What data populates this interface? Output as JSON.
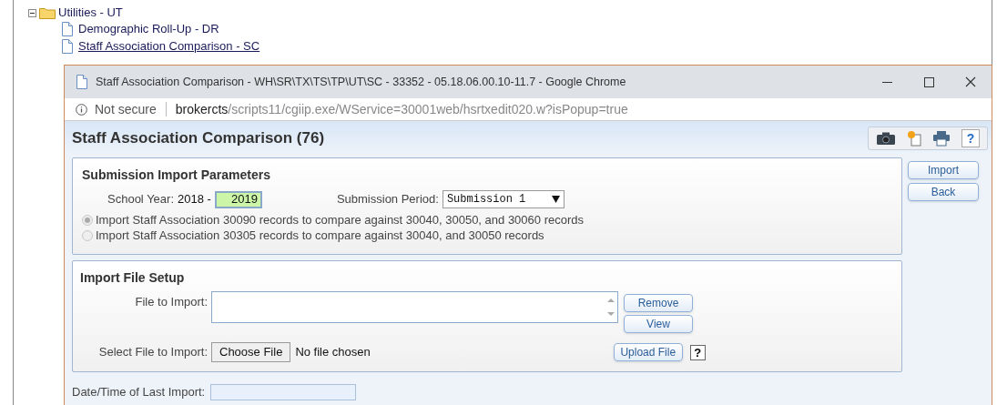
{
  "tree": {
    "label": "Utilities - UT",
    "expanded": true,
    "children": [
      {
        "label": "Demographic Roll-Up - DR",
        "selected": false
      },
      {
        "label": "Staff Association Comparison - SC",
        "selected": true
      }
    ]
  },
  "browser": {
    "title": "Staff Association Comparison - WH\\SR\\TX\\TS\\TP\\UT\\SC - 33352 - 05.18.06.00.10-11.7 - Google Chrome",
    "security": "Not secure",
    "url_host": "brokercts",
    "url_path": "/scripts11/cgiip.exe/WService=30001web/hsrtxedit020.w?isPopup=true"
  },
  "page": {
    "title": "Staff Association Comparison (76)",
    "help_label": "?"
  },
  "params": {
    "heading": "Submission Import Parameters",
    "school_year_label": "School Year:",
    "school_year_start": "2018 -",
    "school_year_end": "2019",
    "period_label": "Submission Period:",
    "period_value": "Submission 1",
    "options": [
      {
        "label": "Import Staff Association 30090 records to compare against 30040, 30050, and 30060 records",
        "selected": true,
        "disabled": true
      },
      {
        "label": "Import Staff Association 30305 records to compare against 30040, and 30050 records",
        "selected": false,
        "disabled": true
      }
    ]
  },
  "side_buttons": [
    "Import",
    "Back"
  ],
  "file_setup": {
    "heading": "Import File Setup",
    "file_label": "File to Import:",
    "remove_button": "Remove",
    "view_button": "View",
    "select_label": "Select File to Import:",
    "choose_button": "Choose File",
    "no_file": "No file chosen",
    "upload_button": "Upload File",
    "help_label": "?"
  },
  "last_import": {
    "label": "Date/Time of Last Import:"
  }
}
